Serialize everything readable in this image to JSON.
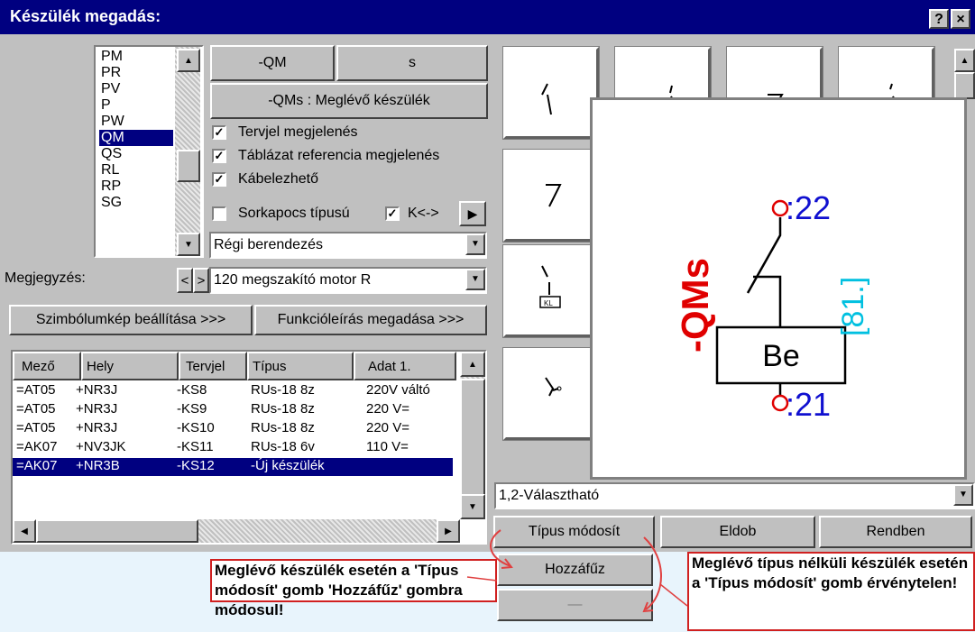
{
  "window": {
    "title": "Készülék megadás:",
    "help": "?",
    "close": "×"
  },
  "prefix_list": {
    "items": [
      "PM",
      "PR",
      "PV",
      "P",
      "PW",
      "QM",
      "QS",
      "RL",
      "RP",
      "SG"
    ],
    "selected": "QM"
  },
  "device": {
    "name_part": "-QM",
    "suffix_part": "s",
    "status": "-QMs  :  Meglévő készülék"
  },
  "options": {
    "tervjel": "Tervjel megjelenés",
    "tablazat": "Táblázat referencia megjelenés",
    "kabelezheto": "Kábelezhető",
    "sorkapocs": "Sorkapocs típusú",
    "k_arrow": "K<->"
  },
  "combo_berendezes": "Régi berendezés",
  "megjegyzes": {
    "label": "Megjegyzés:",
    "value": "120 megszakító motor R"
  },
  "buttons": {
    "szimbolum": "Szimbólumkép beállítása >>>",
    "funkcio": "Funkcióleírás megadása >>>",
    "tipus_modosit": "Típus módosít",
    "eldob": "Eldob",
    "rendben": "Rendben",
    "hozzafuz": "Hozzáfűz",
    "disabled": "—"
  },
  "table": {
    "headers": [
      "Mező",
      "Hely",
      "Tervjel",
      "Típus",
      "Adat 1."
    ],
    "rows": [
      [
        "=AT05",
        "+NR3J",
        "-KS8",
        "RUs-18 8z",
        "220V váltó"
      ],
      [
        "=AT05",
        "+NR3J",
        "-KS9",
        "RUs-18 8z",
        "220 V="
      ],
      [
        "=AT05",
        "+NR3J",
        "-KS10",
        "RUs-18 8z",
        "220 V="
      ],
      [
        "=AK07",
        "+NV3JK",
        "-KS11",
        "RUs-18 6v",
        "110 V="
      ],
      [
        "=AK07",
        "+NR3B",
        "-KS12",
        "-Új készülék",
        ""
      ]
    ]
  },
  "preview": {
    "top_pin": ":22",
    "bottom_pin": ":21",
    "tag": "-QMs",
    "ref": "[81.]",
    "box": "Be"
  },
  "symbol_combo": "1,2-Választható",
  "annotations": {
    "left": "Meglévő készülék esetén a 'Típus módosít' gomb 'Hozzáfűz' gombra módosul!",
    "right": "Meglévő típus nélküli készülék esetén a 'Típus módosít' gomb érvénytelen!"
  },
  "colors": {
    "titlebar": "#000080",
    "selection": "#000080",
    "tag_red": "#e00000",
    "pin_blue": "#1010d0",
    "ref_cyan": "#00c0e0",
    "annotation_border": "#d02020"
  }
}
